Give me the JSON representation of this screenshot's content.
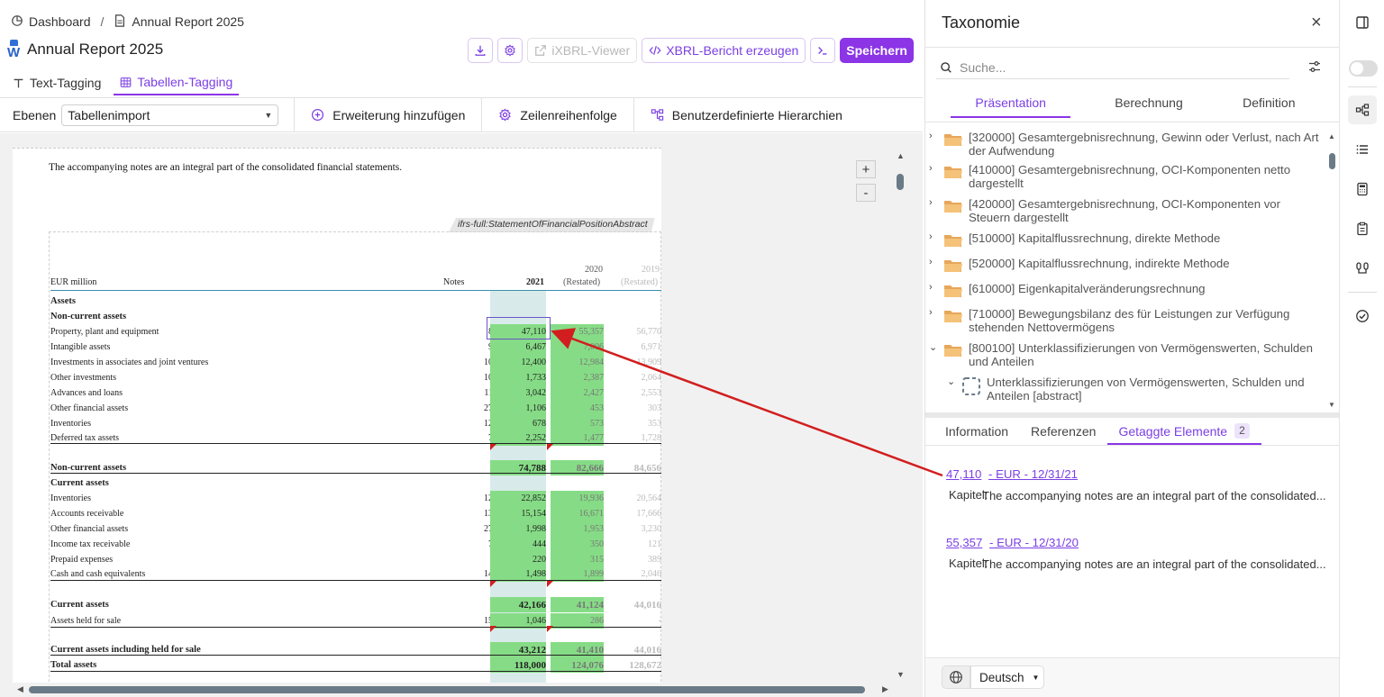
{
  "breadcrumb": {
    "home": "Dashboard",
    "current": "Annual Report 2025"
  },
  "document": {
    "title": "Annual Report 2025"
  },
  "toolbar": {
    "ixbrl_viewer": "iXBRL-Viewer",
    "generate_report": "XBRL-Bericht erzeugen",
    "save": "Speichern"
  },
  "tabs": {
    "text_tagging": "Text-Tagging",
    "table_tagging": "Tabellen-Tagging"
  },
  "levels": {
    "label": "Ebenen",
    "selected": "Tabellenimport",
    "add_extension": "Erweiterung hinzufügen",
    "row_order": "Zeilenreihenfolge",
    "custom_hierarchies": "Benutzerdefinierte Hierarchien"
  },
  "canvas": {
    "zoom_in": "+",
    "zoom_out": "-",
    "note": "The accompanying notes are an integral part of the consolidated financial statements.",
    "tag_label": "ifrs-full:StatementOfFinancialPositionAbstract",
    "header": {
      "unit": "EUR million",
      "notes": "Notes",
      "y2021": "2021",
      "y2020": "2020",
      "y2020_sub": "(Restated)",
      "y2019": "2019",
      "y2019_sub": "(Restated)"
    },
    "rows": [
      {
        "label": "Assets",
        "heading": true
      },
      {
        "label": "Non-current assets",
        "heading": true
      },
      {
        "label": "Property, plant and equipment",
        "note": "8",
        "v2021": "47,110",
        "v2020": "55,357",
        "v2019": "56,770"
      },
      {
        "label": "Intangible assets",
        "note": "9",
        "v2021": "6,467",
        "v2020": "7,006",
        "v2019": "6,971"
      },
      {
        "label": "Investments in associates and joint ventures",
        "note": "10",
        "v2021": "12,400",
        "v2020": "12,984",
        "v2019": "13,909"
      },
      {
        "label": "Other investments",
        "note": "10",
        "v2021": "1,733",
        "v2020": "2,387",
        "v2019": "2,064"
      },
      {
        "label": "Advances and loans",
        "note": "11",
        "v2021": "3,042",
        "v2020": "2,427",
        "v2019": "2,553"
      },
      {
        "label": "Other financial assets",
        "note": "27",
        "v2021": "1,106",
        "v2020": "453",
        "v2019": "303"
      },
      {
        "label": "Inventories",
        "note": "12",
        "v2021": "678",
        "v2020": "573",
        "v2019": "353"
      },
      {
        "label": "Deferred tax assets",
        "note": "7",
        "v2021": "2,252",
        "v2020": "1,477",
        "v2019": "1,728"
      },
      {
        "label": "Non-current assets",
        "total": true,
        "v2021": "74,788",
        "v2020": "82,666",
        "v2019": "84,656"
      },
      {
        "label": "Current assets",
        "heading": true
      },
      {
        "label": "Inventories",
        "note": "12",
        "v2021": "22,852",
        "v2020": "19,936",
        "v2019": "20,564"
      },
      {
        "label": "Accounts receivable",
        "note": "13",
        "v2021": "15,154",
        "v2020": "16,671",
        "v2019": "17,666"
      },
      {
        "label": "Other financial assets",
        "note": "27",
        "v2021": "1,998",
        "v2020": "1,953",
        "v2019": "3,230"
      },
      {
        "label": "Income tax receivable",
        "note": "7",
        "v2021": "444",
        "v2020": "350",
        "v2019": "121"
      },
      {
        "label": "Prepaid expenses",
        "v2021": "220",
        "v2020": "315",
        "v2019": "389"
      },
      {
        "label": "Cash and cash equivalents",
        "note": "14",
        "v2021": "1,498",
        "v2020": "1,899",
        "v2019": "2,046"
      },
      {
        "label": "Current assets",
        "total": true,
        "v2021": "42,166",
        "v2020": "41,124",
        "v2019": "44,016"
      },
      {
        "label": "Assets held for sale",
        "note": "15",
        "v2021": "1,046",
        "v2020": "286",
        "v2019": "-"
      },
      {
        "label": "Current assets including held for sale",
        "total": true,
        "v2021": "43,212",
        "v2020": "41,410",
        "v2019": "44,016"
      },
      {
        "label": "Total assets",
        "total": true,
        "v2021": "118,000",
        "v2020": "124,076",
        "v2019": "128,672"
      }
    ]
  },
  "panel": {
    "title": "Taxonomie",
    "close": "×",
    "search_placeholder": "Suche...",
    "tabs": [
      "Präsentation",
      "Berechnung",
      "Definition"
    ],
    "tree": [
      {
        "text": "[320000] Gesamtergebnisrechnung, Gewinn oder Verlust, nach Art der Aufwendung",
        "chevron": "›"
      },
      {
        "text": "[410000] Gesamtergebnisrechnung, OCI-Komponenten netto dargestellt",
        "chevron": "›"
      },
      {
        "text": "[420000] Gesamtergebnisrechnung, OCI-Komponenten vor Steuern dargestellt",
        "chevron": "›"
      },
      {
        "text": "[510000] Kapitalflussrechnung, direkte Methode",
        "chevron": "›"
      },
      {
        "text": "[520000] Kapitalflussrechnung, indirekte Methode",
        "chevron": "›"
      },
      {
        "text": "[610000] Eigenkapitalveränderungsrechnung",
        "chevron": "›"
      },
      {
        "text": "[710000] Bewegungsbilanz des für Leistungen zur Verfügung stehenden Nettovermögens",
        "chevron": "›"
      },
      {
        "text": "[800100] Unterklassifizierungen von Vermögenswerten, Schulden und Anteilen",
        "chevron": "⌄"
      },
      {
        "text": "Unterklassifizierungen von Vermögenswerten, Schulden und Anteilen [abstract]",
        "chevron": "⌄",
        "child": true
      }
    ],
    "bottom_tabs": {
      "info": "Information",
      "refs": "Referenzen",
      "tagged": "Getaggte Elemente",
      "count": "2"
    },
    "tagged_elements": [
      {
        "value": "47,110",
        "context": "- EUR - 12/31/21",
        "key": "Kapitel:",
        "text": "The accompanying notes are an integral part of the consolidated..."
      },
      {
        "value": "55,357",
        "context": "- EUR - 12/31/20",
        "key": "Kapitel:",
        "text": "The accompanying notes are an integral part of the consolidated..."
      }
    ],
    "language": "Deutsch"
  },
  "colors": {
    "accent": "#8b35e6",
    "tag_green": "#86dc86",
    "arrow": "#d21e1e"
  }
}
